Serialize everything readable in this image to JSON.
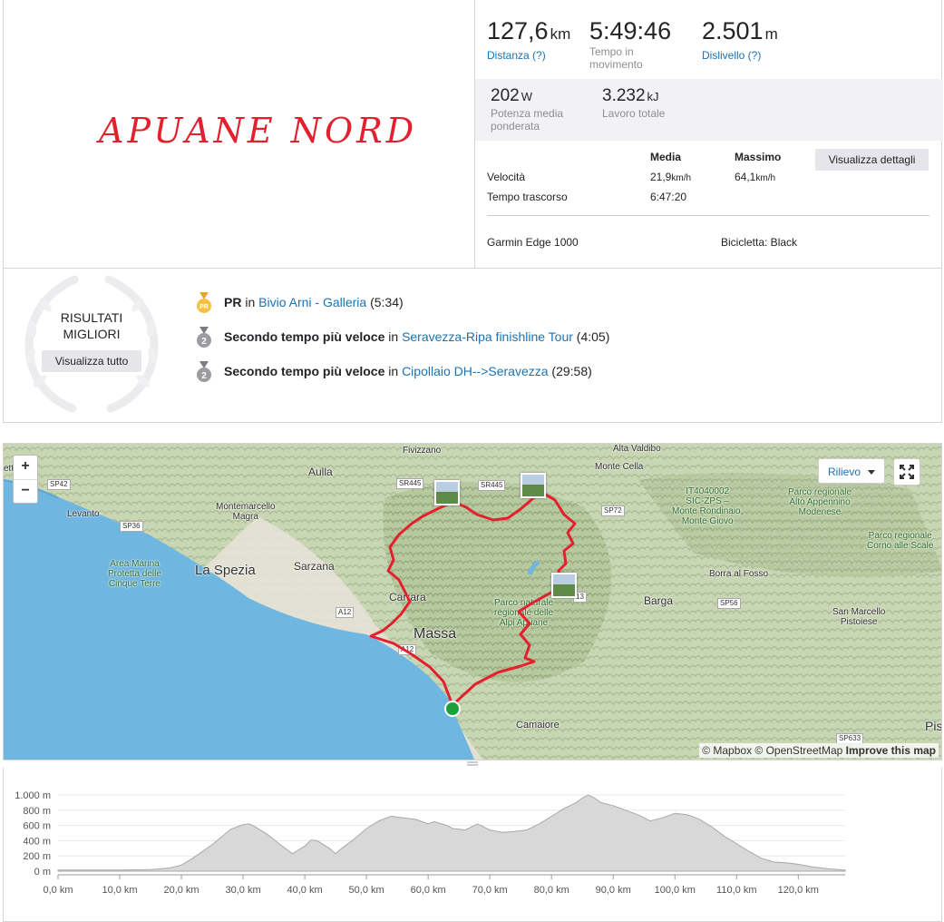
{
  "activity": {
    "title": "APUANE NORD"
  },
  "stats": {
    "distance": {
      "value": "127,6",
      "unit": "km",
      "label": "Distanza (?)"
    },
    "moving_time": {
      "value": "5:49:46",
      "label_line1": "Tempo in",
      "label_line2": "movimento"
    },
    "elevation": {
      "value": "2.501",
      "unit": "m",
      "label": "Dislivello (?)"
    },
    "power": {
      "value": "202",
      "unit": "W",
      "label_line1": "Potenza media",
      "label_line2": "ponderata"
    },
    "work": {
      "value": "3.232",
      "unit": "kJ",
      "label": "Lavoro totale"
    },
    "table": {
      "col_avg": "Media",
      "col_max": "Massimo",
      "speed_label": "Velocità",
      "speed_avg": "21,9",
      "speed_avg_unit": "km/h",
      "speed_max": "64,1",
      "speed_max_unit": "km/h",
      "elapsed_label": "Tempo trascorso",
      "elapsed_avg": "6:47:20"
    },
    "details_button": "Visualizza dettagli",
    "device": "Garmin Edge 1000",
    "bike": "Bicicletta: Black"
  },
  "achievements": {
    "title_line1": "RISULTATI",
    "title_line2": "MIGLIORI",
    "view_all": "Visualizza tutto",
    "items": [
      {
        "medal": "PR",
        "rank": "PR",
        "in": "in",
        "segment": "Bivio Arni - Galleria",
        "time": "(5:34)"
      },
      {
        "medal": "2",
        "rank": "Secondo tempo più veloce",
        "in": "in",
        "segment": "Seravezza-Ripa finishline Tour",
        "time": "(4:05)"
      },
      {
        "medal": "2",
        "rank": "Secondo tempo più veloce",
        "in": "in",
        "segment": "Cipollaio DH-->Seravezza",
        "time": "(29:58)"
      }
    ],
    "colors": {
      "pr": "#f6c142",
      "second": "#9b9ba0"
    }
  },
  "map": {
    "zoom_in": "+",
    "zoom_out": "−",
    "layer": "Rilievo",
    "attribution_1": "© Mapbox © OpenStreetMap",
    "attribution_2": "Improve this map",
    "route_color": "#e4202f",
    "start_color": "#1aa238",
    "labels": {
      "fivizzano": "Fivizzano",
      "aulla": "Aulla",
      "montemarcello": "Montemarcello\nMagra",
      "levanto": "Levanto",
      "area_marina": "Area Marina\nProtetta delle\nCinque Terre",
      "la_spezia": "La Spezia",
      "sarzana": "Sarzana",
      "carrara": "Carrara",
      "massa": "Massa",
      "parco_apuane": "Parco naturale\nregionale delle\nAlpi Apuane",
      "monte_cella": "Monte Cella",
      "sic": "IT4040002\nSIC-ZPS –\nMonte Rondinaio,\nMonte Giovo",
      "parco_appennino": "Parco regionale\nAlto Appennino\nModenese",
      "parco_corno": "Parco regionale\nCorno alle Scale",
      "borra": "Borra al Fosso",
      "barga": "Barga",
      "san_marcello": "San Marcello\nPistoiese",
      "camaiore": "Camaiore",
      "pisa": "Pis",
      "etta": "etta",
      "alta": "Alta Valdibo"
    },
    "roads": [
      "SP42",
      "SP36",
      "SR445",
      "SR445",
      "SP72",
      "A12",
      "A12",
      "SP56",
      "SP633",
      "13"
    ]
  },
  "elevation_profile": {
    "y_labels": [
      "1.000 m",
      "800 m",
      "600 m",
      "400 m",
      "200 m",
      "0 m"
    ],
    "x_labels": [
      "0,0 km",
      "10,0 km",
      "20,0 km",
      "30,0 km",
      "40,0 km",
      "50,0 km",
      "60,0 km",
      "70,0 km",
      "80,0 km",
      "90,0 km",
      "100,0 km",
      "110,0 km",
      "120,0 km"
    ],
    "profile": [
      [
        0,
        15
      ],
      [
        10,
        15
      ],
      [
        15,
        20
      ],
      [
        18,
        40
      ],
      [
        20,
        80
      ],
      [
        22,
        180
      ],
      [
        25,
        350
      ],
      [
        28,
        550
      ],
      [
        30,
        610
      ],
      [
        31,
        620
      ],
      [
        32,
        580
      ],
      [
        34,
        480
      ],
      [
        36,
        350
      ],
      [
        38,
        230
      ],
      [
        40,
        330
      ],
      [
        41,
        410
      ],
      [
        42,
        400
      ],
      [
        43,
        350
      ],
      [
        44,
        300
      ],
      [
        45,
        230
      ],
      [
        46,
        300
      ],
      [
        48,
        420
      ],
      [
        50,
        560
      ],
      [
        52,
        660
      ],
      [
        54,
        720
      ],
      [
        56,
        700
      ],
      [
        58,
        680
      ],
      [
        60,
        620
      ],
      [
        61,
        650
      ],
      [
        63,
        600
      ],
      [
        64,
        560
      ],
      [
        66,
        540
      ],
      [
        68,
        620
      ],
      [
        70,
        540
      ],
      [
        72,
        510
      ],
      [
        74,
        520
      ],
      [
        76,
        540
      ],
      [
        78,
        620
      ],
      [
        80,
        720
      ],
      [
        82,
        820
      ],
      [
        84,
        900
      ],
      [
        85,
        960
      ],
      [
        86,
        1000
      ],
      [
        87,
        960
      ],
      [
        88,
        900
      ],
      [
        90,
        860
      ],
      [
        92,
        800
      ],
      [
        94,
        740
      ],
      [
        96,
        660
      ],
      [
        98,
        700
      ],
      [
        100,
        760
      ],
      [
        102,
        740
      ],
      [
        104,
        680
      ],
      [
        106,
        580
      ],
      [
        108,
        460
      ],
      [
        110,
        360
      ],
      [
        112,
        260
      ],
      [
        114,
        170
      ],
      [
        116,
        120
      ],
      [
        118,
        110
      ],
      [
        120,
        90
      ],
      [
        122,
        60
      ],
      [
        125,
        30
      ],
      [
        127.6,
        15
      ]
    ],
    "fill_color": "#d8d8d8",
    "line_color": "#a8a8a8"
  }
}
